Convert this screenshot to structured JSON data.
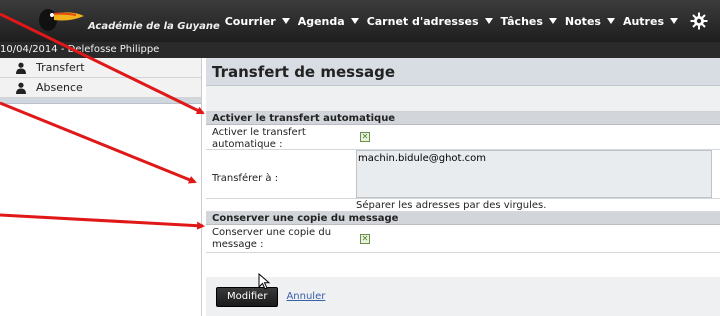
{
  "app": {
    "brand": "Académie de la Guyane",
    "session_line": "10/04/2014 - Delefosse Philippe",
    "accent": "#d11a1a"
  },
  "menu": {
    "items": [
      {
        "label": "Courrier"
      },
      {
        "label": "Agenda"
      },
      {
        "label": "Carnet d'adresses"
      },
      {
        "label": "Tâches"
      },
      {
        "label": "Notes"
      },
      {
        "label": "Autres"
      }
    ],
    "settings_icon": "gear-icon"
  },
  "sidebar": {
    "items": [
      {
        "label": "Transfert",
        "icon": "user-icon"
      },
      {
        "label": "Absence",
        "icon": "user-icon"
      }
    ]
  },
  "main": {
    "title": "Transfert de message",
    "section1": {
      "heading": "Activer le transfert automatique",
      "enable_label": "Activer le transfert automatique :",
      "enable_checked": true,
      "forward_label": "Transférer à :",
      "forward_value": "machin.bidule@ghot.com",
      "hint": "Séparer les adresses par des virgules."
    },
    "section2": {
      "heading": "Conserver une copie du message",
      "keep_label": "Conserver une copie du message :",
      "keep_checked": true
    },
    "actions": {
      "submit_label": "Modifier",
      "cancel_label": "Annuler"
    }
  },
  "annotations": {
    "arrow_color": "#e01818",
    "count": 3
  }
}
